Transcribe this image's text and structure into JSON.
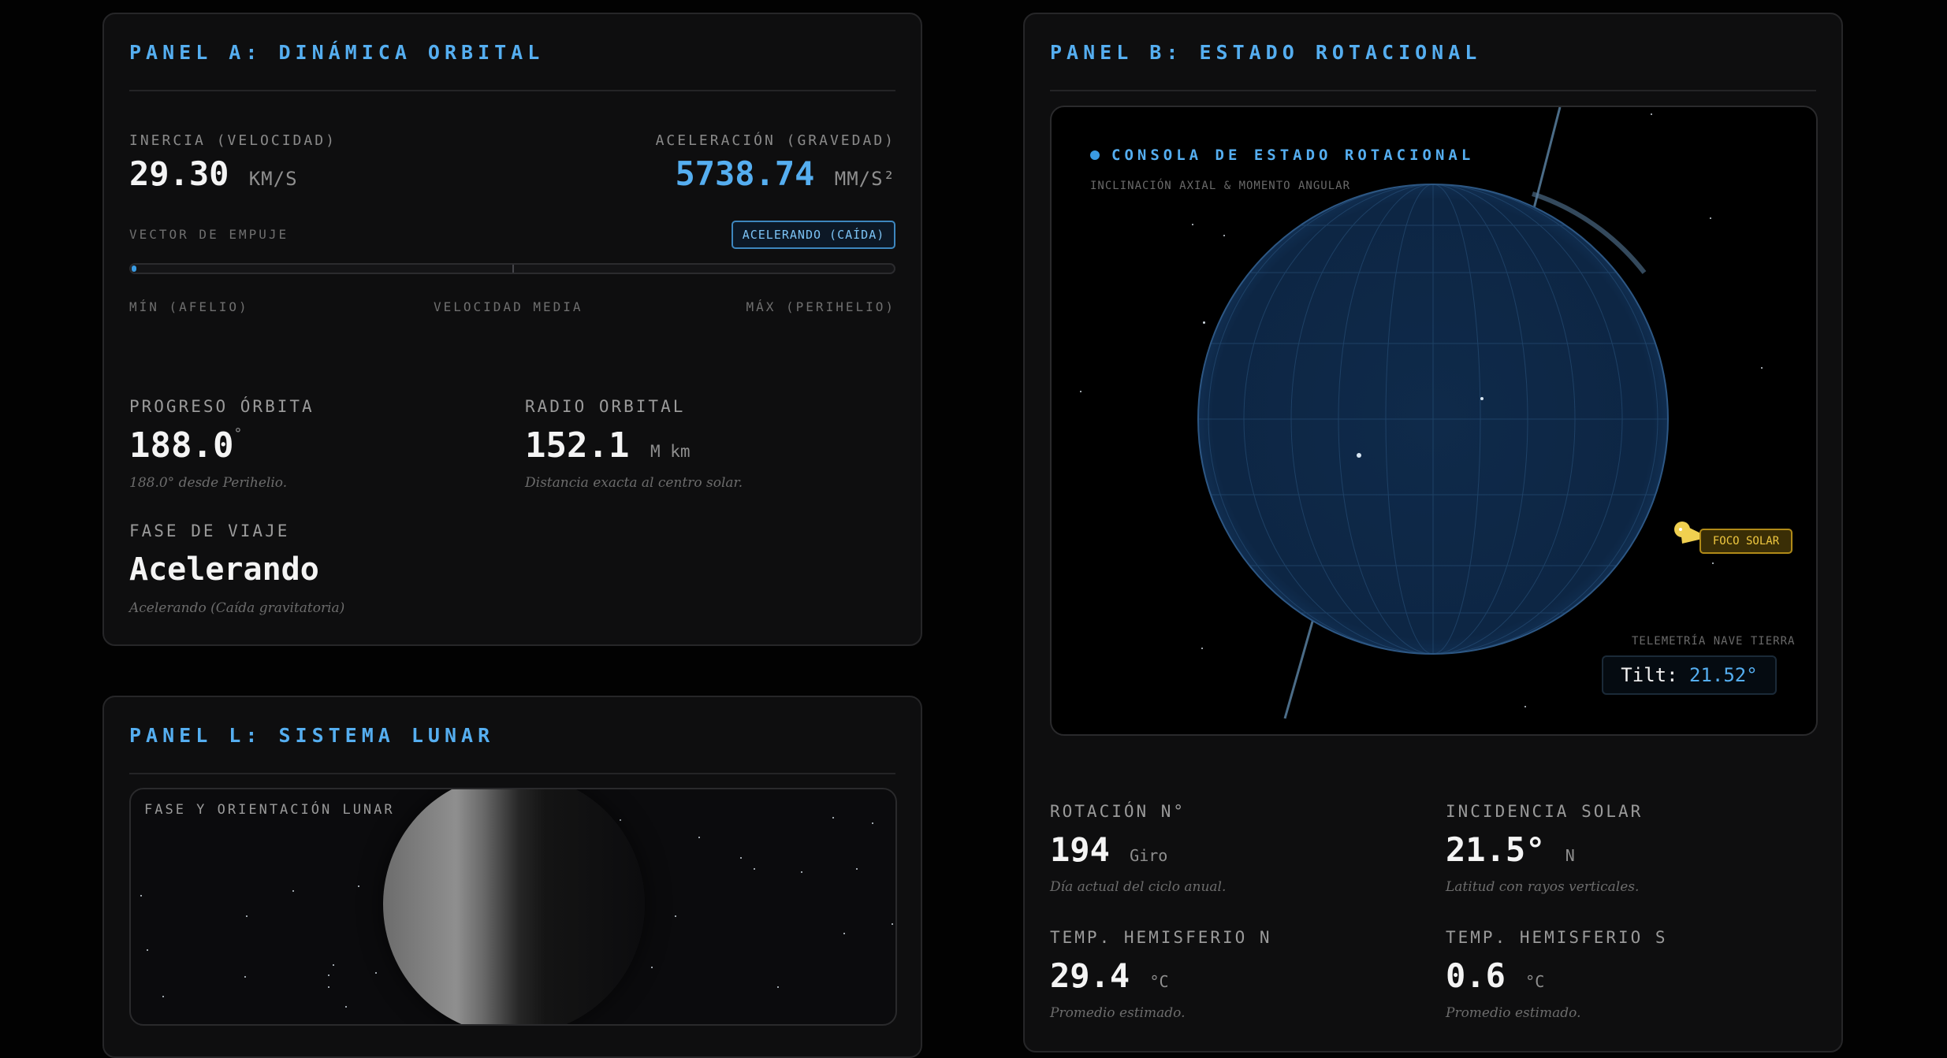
{
  "panel_a": {
    "title": "PANEL A: DINÁMICA ORBITAL",
    "inercia": {
      "label": "INERCIA (VELOCIDAD)",
      "value": "29.30",
      "unit": "KM/S"
    },
    "aceleracion": {
      "label": "ACELERACIÓN (GRAVEDAD)",
      "value": "5738.74",
      "unit": "MM/S²"
    },
    "vector": {
      "label": "VECTOR DE EMPUJE",
      "badge": "ACELERANDO (CAÍDA)",
      "progress": 0.005,
      "scale_min": "MÍN (AFELIO)",
      "scale_mid": "VELOCIDAD MEDIA",
      "scale_max": "MÁX (PERIHELIO)"
    },
    "progreso": {
      "label": "PROGRESO ÓRBITA",
      "value": "188.0",
      "unit": "°",
      "note": "188.0° desde Perihelio."
    },
    "radio": {
      "label": "RADIO ORBITAL",
      "value": "152.1",
      "unit": "M km",
      "note": "Distancia exacta al centro solar."
    },
    "fase": {
      "label": "FASE DE VIAJE",
      "value": "Acelerando",
      "note": "Acelerando (Caída gravitatoria)"
    }
  },
  "panel_b": {
    "title": "PANEL B: ESTADO ROTACIONAL",
    "console": {
      "title": "CONSOLA DE ESTADO ROTACIONAL",
      "subtitle": "INCLINACIÓN AXIAL & MOMENTO ANGULAR",
      "sun_label": "FOCO SOLAR",
      "telemetry_label": "TELEMETRÍA NAVE TIERRA",
      "tilt_label": "Tilt:",
      "tilt_value": "21.52°"
    },
    "rotacion": {
      "label": "ROTACIÓN N°",
      "value": "194",
      "unit": "Giro",
      "note": "Día actual del ciclo anual."
    },
    "incidencia": {
      "label": "INCIDENCIA SOLAR",
      "value": "21.5°",
      "unit": "N",
      "note": "Latitud con rayos verticales."
    },
    "temp_n": {
      "label": "TEMP. HEMISFERIO N",
      "value": "29.4",
      "unit": "°C",
      "note": "Promedio estimado."
    },
    "temp_s": {
      "label": "TEMP. HEMISFERIO S",
      "value": "0.6",
      "unit": "°C",
      "note": "Promedio estimado."
    }
  },
  "panel_l": {
    "title": "PANEL L: SISTEMA LUNAR",
    "viewport_label": "FASE Y ORIENTACIÓN LUNAR"
  },
  "colors": {
    "accent": "#55aef0",
    "sun": "#f0d050",
    "earth": "#0f2a4a",
    "background": "#020202"
  }
}
